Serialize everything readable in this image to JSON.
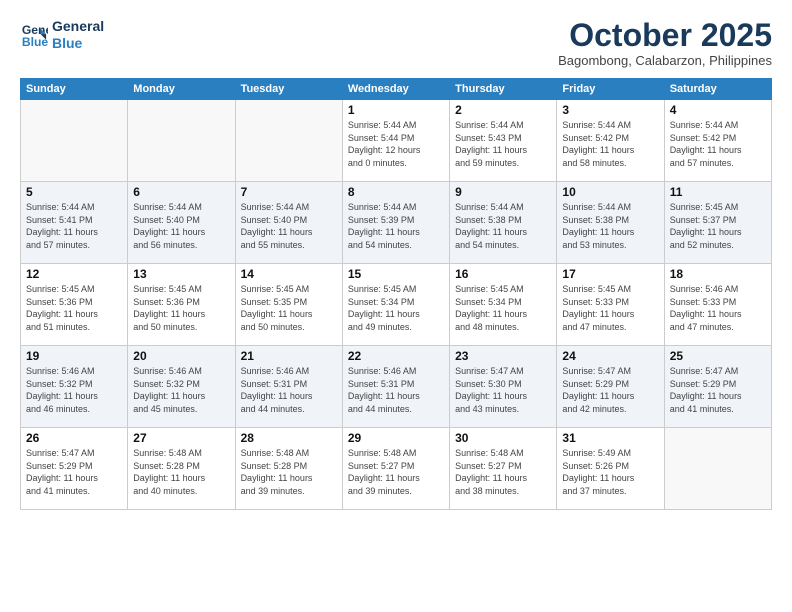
{
  "header": {
    "logo_line1": "General",
    "logo_line2": "Blue",
    "month": "October 2025",
    "location": "Bagombong, Calabarzon, Philippines"
  },
  "weekdays": [
    "Sunday",
    "Monday",
    "Tuesday",
    "Wednesday",
    "Thursday",
    "Friday",
    "Saturday"
  ],
  "weeks": [
    [
      {
        "day": "",
        "info": ""
      },
      {
        "day": "",
        "info": ""
      },
      {
        "day": "",
        "info": ""
      },
      {
        "day": "1",
        "info": "Sunrise: 5:44 AM\nSunset: 5:44 PM\nDaylight: 12 hours\nand 0 minutes."
      },
      {
        "day": "2",
        "info": "Sunrise: 5:44 AM\nSunset: 5:43 PM\nDaylight: 11 hours\nand 59 minutes."
      },
      {
        "day": "3",
        "info": "Sunrise: 5:44 AM\nSunset: 5:42 PM\nDaylight: 11 hours\nand 58 minutes."
      },
      {
        "day": "4",
        "info": "Sunrise: 5:44 AM\nSunset: 5:42 PM\nDaylight: 11 hours\nand 57 minutes."
      }
    ],
    [
      {
        "day": "5",
        "info": "Sunrise: 5:44 AM\nSunset: 5:41 PM\nDaylight: 11 hours\nand 57 minutes."
      },
      {
        "day": "6",
        "info": "Sunrise: 5:44 AM\nSunset: 5:40 PM\nDaylight: 11 hours\nand 56 minutes."
      },
      {
        "day": "7",
        "info": "Sunrise: 5:44 AM\nSunset: 5:40 PM\nDaylight: 11 hours\nand 55 minutes."
      },
      {
        "day": "8",
        "info": "Sunrise: 5:44 AM\nSunset: 5:39 PM\nDaylight: 11 hours\nand 54 minutes."
      },
      {
        "day": "9",
        "info": "Sunrise: 5:44 AM\nSunset: 5:38 PM\nDaylight: 11 hours\nand 54 minutes."
      },
      {
        "day": "10",
        "info": "Sunrise: 5:44 AM\nSunset: 5:38 PM\nDaylight: 11 hours\nand 53 minutes."
      },
      {
        "day": "11",
        "info": "Sunrise: 5:45 AM\nSunset: 5:37 PM\nDaylight: 11 hours\nand 52 minutes."
      }
    ],
    [
      {
        "day": "12",
        "info": "Sunrise: 5:45 AM\nSunset: 5:36 PM\nDaylight: 11 hours\nand 51 minutes."
      },
      {
        "day": "13",
        "info": "Sunrise: 5:45 AM\nSunset: 5:36 PM\nDaylight: 11 hours\nand 50 minutes."
      },
      {
        "day": "14",
        "info": "Sunrise: 5:45 AM\nSunset: 5:35 PM\nDaylight: 11 hours\nand 50 minutes."
      },
      {
        "day": "15",
        "info": "Sunrise: 5:45 AM\nSunset: 5:34 PM\nDaylight: 11 hours\nand 49 minutes."
      },
      {
        "day": "16",
        "info": "Sunrise: 5:45 AM\nSunset: 5:34 PM\nDaylight: 11 hours\nand 48 minutes."
      },
      {
        "day": "17",
        "info": "Sunrise: 5:45 AM\nSunset: 5:33 PM\nDaylight: 11 hours\nand 47 minutes."
      },
      {
        "day": "18",
        "info": "Sunrise: 5:46 AM\nSunset: 5:33 PM\nDaylight: 11 hours\nand 47 minutes."
      }
    ],
    [
      {
        "day": "19",
        "info": "Sunrise: 5:46 AM\nSunset: 5:32 PM\nDaylight: 11 hours\nand 46 minutes."
      },
      {
        "day": "20",
        "info": "Sunrise: 5:46 AM\nSunset: 5:32 PM\nDaylight: 11 hours\nand 45 minutes."
      },
      {
        "day": "21",
        "info": "Sunrise: 5:46 AM\nSunset: 5:31 PM\nDaylight: 11 hours\nand 44 minutes."
      },
      {
        "day": "22",
        "info": "Sunrise: 5:46 AM\nSunset: 5:31 PM\nDaylight: 11 hours\nand 44 minutes."
      },
      {
        "day": "23",
        "info": "Sunrise: 5:47 AM\nSunset: 5:30 PM\nDaylight: 11 hours\nand 43 minutes."
      },
      {
        "day": "24",
        "info": "Sunrise: 5:47 AM\nSunset: 5:29 PM\nDaylight: 11 hours\nand 42 minutes."
      },
      {
        "day": "25",
        "info": "Sunrise: 5:47 AM\nSunset: 5:29 PM\nDaylight: 11 hours\nand 41 minutes."
      }
    ],
    [
      {
        "day": "26",
        "info": "Sunrise: 5:47 AM\nSunset: 5:29 PM\nDaylight: 11 hours\nand 41 minutes."
      },
      {
        "day": "27",
        "info": "Sunrise: 5:48 AM\nSunset: 5:28 PM\nDaylight: 11 hours\nand 40 minutes."
      },
      {
        "day": "28",
        "info": "Sunrise: 5:48 AM\nSunset: 5:28 PM\nDaylight: 11 hours\nand 39 minutes."
      },
      {
        "day": "29",
        "info": "Sunrise: 5:48 AM\nSunset: 5:27 PM\nDaylight: 11 hours\nand 39 minutes."
      },
      {
        "day": "30",
        "info": "Sunrise: 5:48 AM\nSunset: 5:27 PM\nDaylight: 11 hours\nand 38 minutes."
      },
      {
        "day": "31",
        "info": "Sunrise: 5:49 AM\nSunset: 5:26 PM\nDaylight: 11 hours\nand 37 minutes."
      },
      {
        "day": "",
        "info": ""
      }
    ]
  ]
}
